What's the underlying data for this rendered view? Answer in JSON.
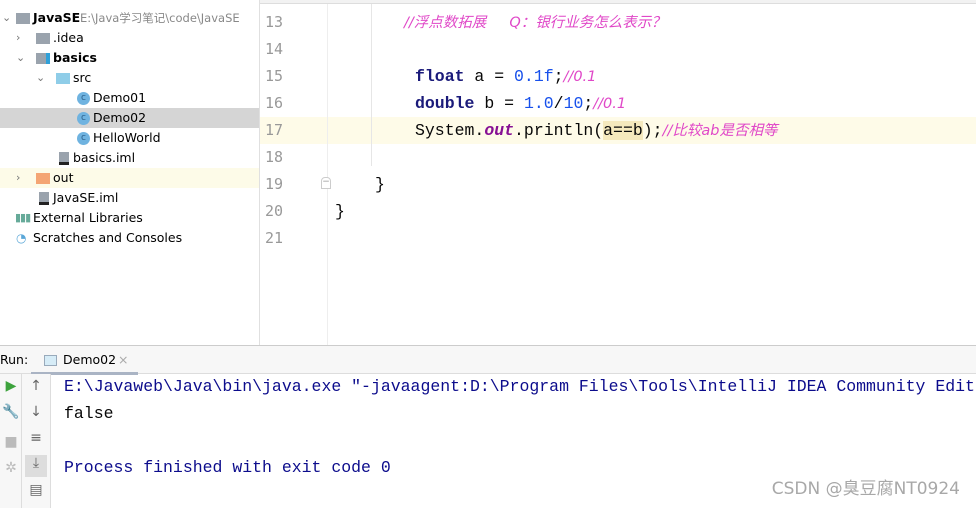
{
  "project_tree": {
    "root": {
      "label": "JavaSE",
      "path": "E:\\Java学习笔记\\code\\JavaSE"
    },
    "items": [
      {
        "label": ".idea"
      },
      {
        "label": "basics"
      },
      {
        "label": "src"
      },
      {
        "label": "Demo01"
      },
      {
        "label": "Demo02"
      },
      {
        "label": "HelloWorld"
      },
      {
        "label": "basics.iml"
      },
      {
        "label": "out"
      },
      {
        "label": "JavaSE.iml"
      },
      {
        "label": "External Libraries"
      },
      {
        "label": "Scratches and Consoles"
      }
    ]
  },
  "editor": {
    "line_numbers": [
      "13",
      "14",
      "15",
      "16",
      "17",
      "18",
      "19",
      "20",
      "21"
    ],
    "line13": {
      "comment": "//浮点数拓展     Q：银行业务怎么表示？"
    },
    "line15": {
      "kw": "float",
      "mid": " a = ",
      "num": "0.1f",
      "semi": ";",
      "comment": "//0.1"
    },
    "line16": {
      "kw": "double",
      "mid": " b = ",
      "num": "1.0",
      "op": "/",
      "num2": "10",
      "semi": ";",
      "comment": "//0.1"
    },
    "line17": {
      "pre": "System.",
      "field": "out",
      "mid": ".println(",
      "hl": "a==b",
      "post": ");",
      "comment": "//比较ab是否相等"
    },
    "line19": "}",
    "line20": "}"
  },
  "run_panel": {
    "label": "Run:",
    "tab": "Demo02",
    "close": "×",
    "output": [
      "E:\\Javaweb\\Java\\bin\\java.exe \"-javaagent:D:\\Program Files\\Tools\\IntelliJ IDEA Community Edition",
      "false",
      "",
      "Process finished with exit code 0"
    ]
  },
  "watermark": "CSDN @臭豆腐NT0924",
  "colors": {
    "keyword": "#1a1a7a",
    "number": "#1750eb",
    "comment": "#e048c8",
    "console_cmd": "#0c0c8c",
    "selection": "#d5d5d5"
  }
}
